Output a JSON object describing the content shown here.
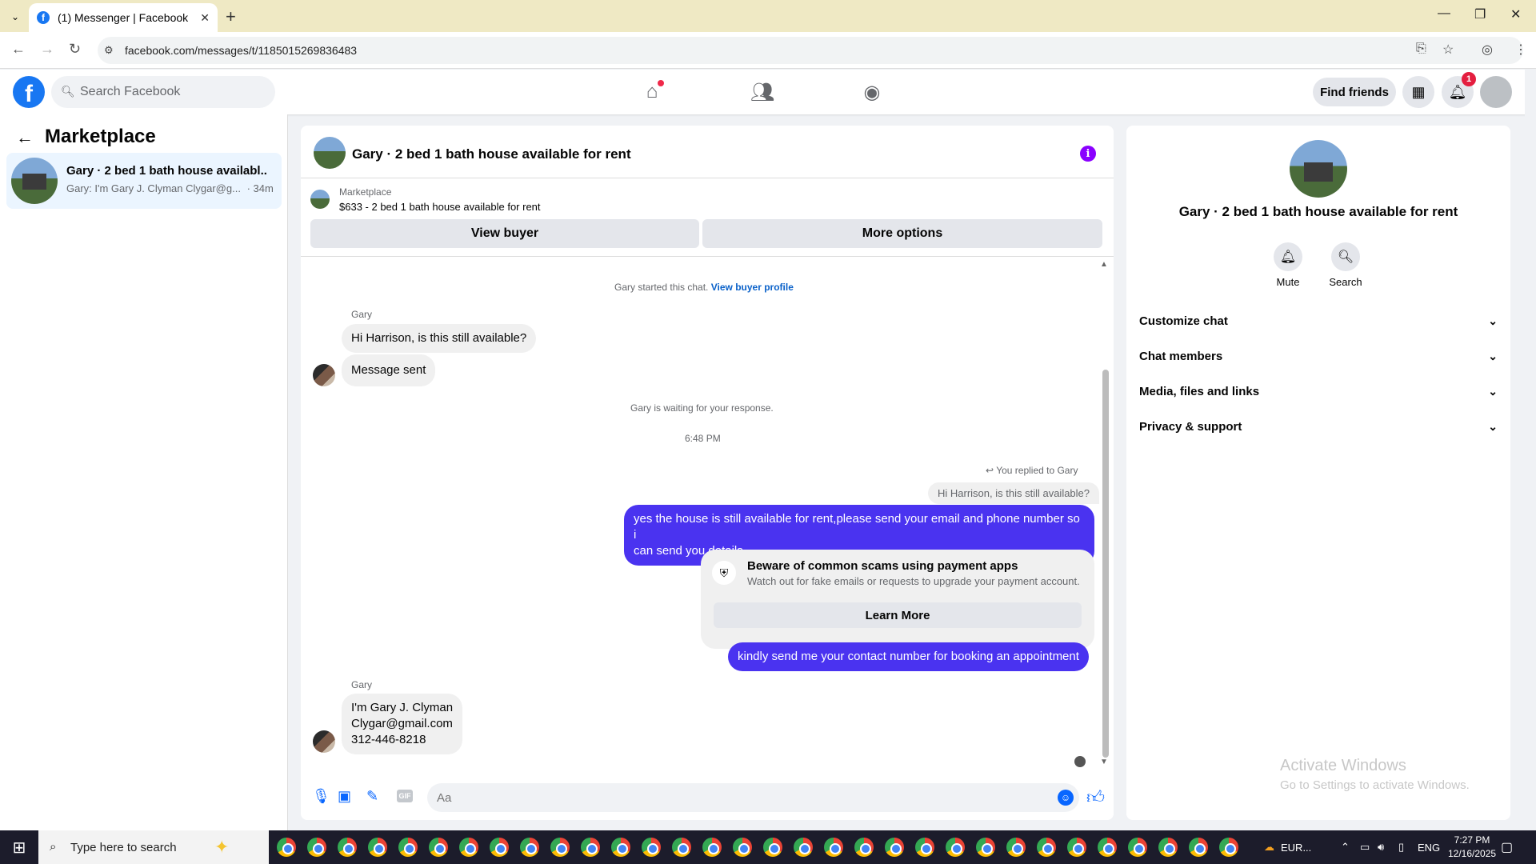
{
  "browser": {
    "tab_title": "(1) Messenger | Facebook",
    "url": "facebook.com/messages/t/1185015269836483"
  },
  "header": {
    "search_placeholder": "Search Facebook",
    "find_friends": "Find friends",
    "notification_count": "1"
  },
  "left": {
    "title": "Marketplace",
    "conversation": {
      "name": "Gary · 2 bed 1 bath house availabl...",
      "snippet": "Gary: I'm Gary J. Clyman Clygar@g...",
      "time": "· 34m"
    }
  },
  "chat": {
    "title": "Gary · 2 bed 1 bath house available for rent",
    "marketplace_label": "Marketplace",
    "listing": "$633 - 2 bed 1 bath house available for rent",
    "view_buyer": "View buyer",
    "more_options": "More options",
    "started_text": "Gary started this chat.",
    "view_buyer_profile": "View buyer profile",
    "sender_name": "Gary",
    "msg1": "Hi Harrison, is this still available?",
    "msg2": "Message sent",
    "waiting": "Gary is waiting for your response.",
    "time": "6:48 PM",
    "replied_to": "You replied to Gary",
    "quoted": "Hi Harrison, is this still available?",
    "out1_line1": "yes the house is still available for rent,please send your email and phone number so i",
    "out1_line2": "can send you details",
    "scam_title": "Beware of common scams using payment apps",
    "scam_sub": "Watch out for fake emails or requests to upgrade your payment account.",
    "learn_more": "Learn More",
    "out2": "kindly send me your contact number for booking an appointment",
    "in3_line1": "I'm Gary J. Clyman",
    "in3_line2": "Clygar@gmail.com",
    "in3_line3": "312-446-8218",
    "input_placeholder": "Aa"
  },
  "right": {
    "name": "Gary · 2 bed 1 bath house available for rent",
    "mute": "Mute",
    "search": "Search",
    "sections": [
      "Customize chat",
      "Chat members",
      "Media, files and links",
      "Privacy & support"
    ]
  },
  "watermark": {
    "line1": "Activate Windows",
    "line2": "Go to Settings to activate Windows."
  },
  "taskbar": {
    "search": "Type here to search",
    "weather": "EUR...",
    "lang": "ENG",
    "time": "7:27 PM",
    "date": "12/16/2025"
  },
  "colors": {
    "brand": "#1877f2",
    "outgoing_bubble": "#4a33f0",
    "link": "#0a61c9"
  }
}
